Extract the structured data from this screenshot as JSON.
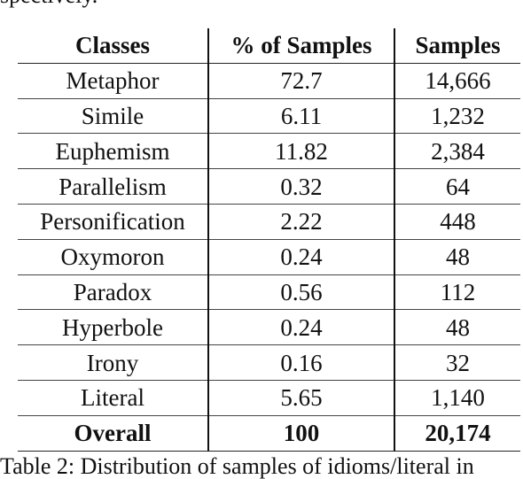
{
  "top_fragment": "spectively.",
  "table": {
    "headers": [
      "Classes",
      "% of Samples",
      "Samples"
    ],
    "rows": [
      {
        "class": "Metaphor",
        "percent": "72.7",
        "samples": "14,666"
      },
      {
        "class": "Simile",
        "percent": "6.11",
        "samples": "1,232"
      },
      {
        "class": "Euphemism",
        "percent": "11.82",
        "samples": "2,384"
      },
      {
        "class": "Parallelism",
        "percent": "0.32",
        "samples": "64"
      },
      {
        "class": "Personification",
        "percent": "2.22",
        "samples": "448"
      },
      {
        "class": "Oxymoron",
        "percent": "0.24",
        "samples": "48"
      },
      {
        "class": "Paradox",
        "percent": "0.56",
        "samples": "112"
      },
      {
        "class": "Hyperbole",
        "percent": "0.24",
        "samples": "48"
      },
      {
        "class": "Irony",
        "percent": "0.16",
        "samples": "32"
      },
      {
        "class": "Literal",
        "percent": "5.65",
        "samples": "1,140"
      }
    ],
    "overall": {
      "class": "Overall",
      "percent": "100",
      "samples": "20,174"
    }
  },
  "caption": "Table 2: Distribution of samples of idioms/literal in"
}
